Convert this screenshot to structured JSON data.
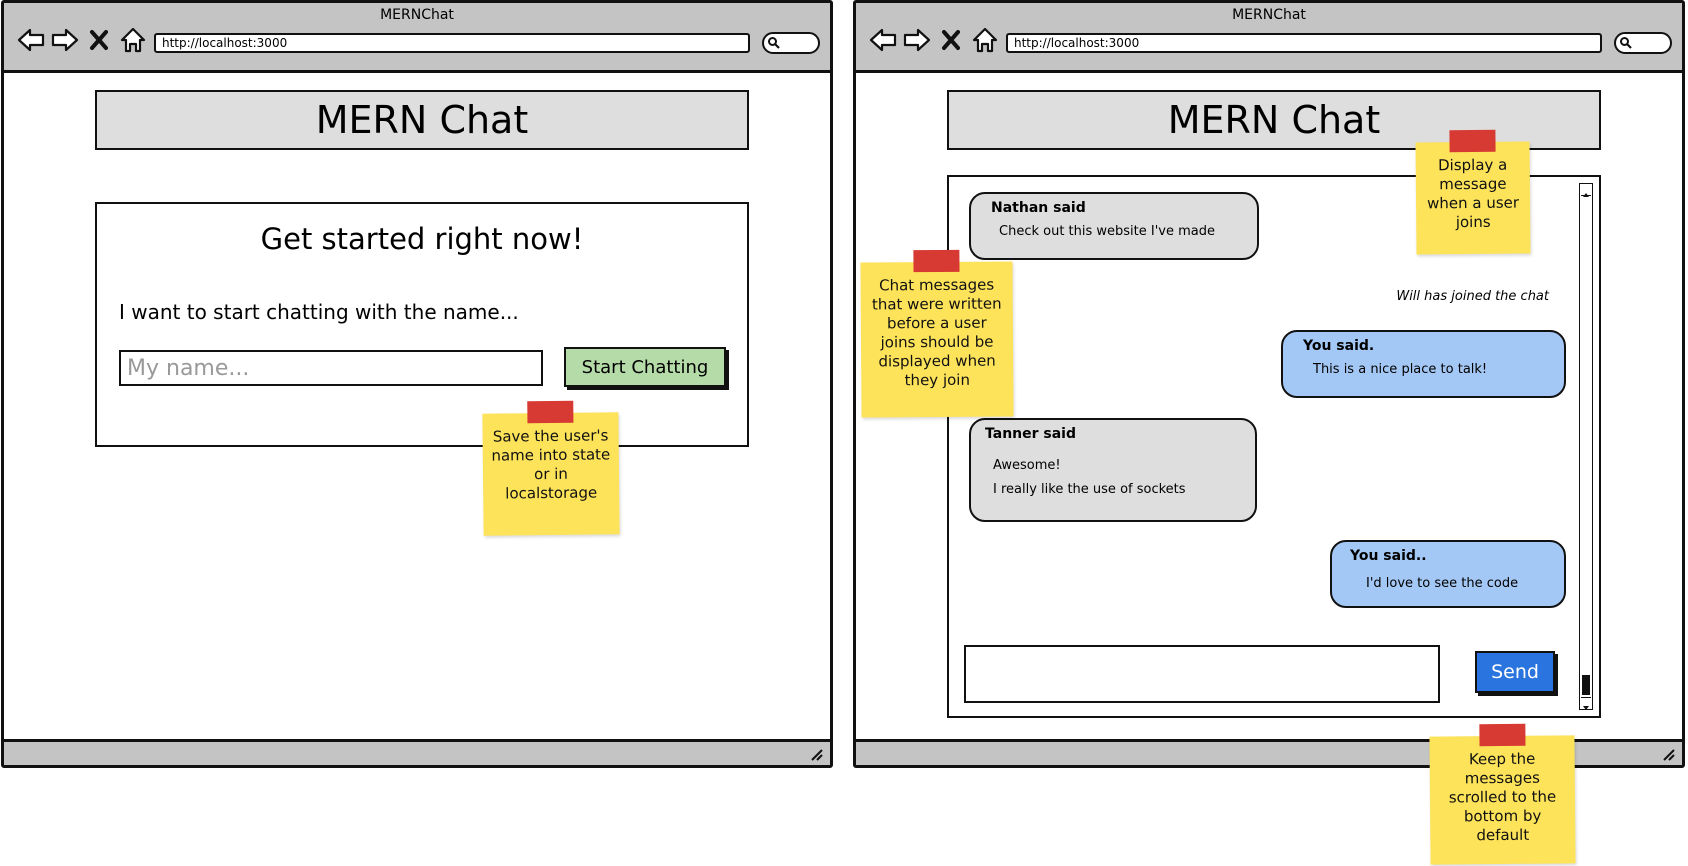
{
  "left_window": {
    "title": "MERNChat",
    "url": "http://localhost:3000",
    "header": "MERN Chat",
    "card": {
      "heading": "Get started right now!",
      "prompt": "I want to start chatting with the name...",
      "name_placeholder": "My name...",
      "start_button": "Start Chatting"
    }
  },
  "right_window": {
    "title": "MERNChat",
    "url": "http://localhost:3000",
    "header": "MERN Chat",
    "messages": [
      {
        "sender": "Nathan said",
        "lines": [
          "Check out this website I've made"
        ],
        "mine": false
      },
      {
        "sender": "You said.",
        "lines": [
          "This is a nice place to talk!"
        ],
        "mine": true
      },
      {
        "sender": "Tanner said",
        "lines": [
          "Awesome!",
          "I really like the use of sockets"
        ],
        "mine": false
      },
      {
        "sender": "You said..",
        "lines": [
          "I'd love to see the code"
        ],
        "mine": true
      }
    ],
    "join_notice": "Will has joined the chat",
    "send_button": "Send"
  },
  "sticky_notes": {
    "save_name": "Save the user's name into state or in localstorage",
    "display_join": "Display a message when a user joins",
    "previous_messages": "Chat messages that were written before a user joins should be displayed when they join",
    "scroll_bottom": "Keep the messages scrolled to the bottom by default"
  },
  "colors": {
    "chrome": "#c4c4c4",
    "header_bg": "#dedede",
    "start_button": "#b5dba8",
    "other_bubble": "#dedede",
    "my_bubble": "#a4c8f5",
    "send_button": "#2a74df",
    "sticky": "#fde35a",
    "tape": "#d63a32"
  },
  "icons": [
    "back-arrow-icon",
    "forward-arrow-icon",
    "close-x-icon",
    "home-icon",
    "search-icon",
    "resize-grip-icon"
  ]
}
